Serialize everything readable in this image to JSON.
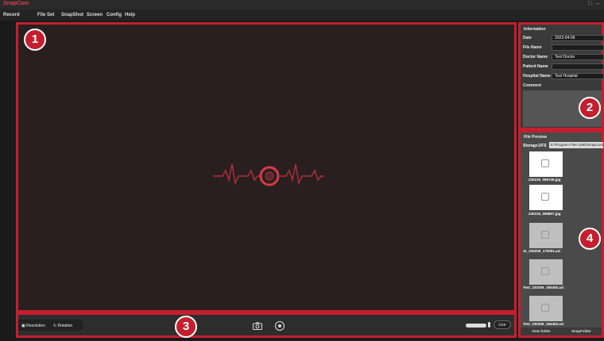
{
  "app": {
    "title": "SnapCam"
  },
  "menu": [
    "Record",
    "File Set",
    "SnapShot",
    "Screen",
    "Config",
    "Help"
  ],
  "badges": {
    "b1": "1",
    "b2": "2",
    "b3": "3",
    "b4": "4"
  },
  "info": {
    "title": "Information",
    "rows": [
      {
        "label": "Date",
        "value": "2023-04-06"
      },
      {
        "label": "File Name",
        "value": ""
      },
      {
        "label": "Doctor Name",
        "value": "Test Doctor"
      },
      {
        "label": "Patient Name",
        "value": ""
      },
      {
        "label": "Hospital Name",
        "value": "Test Hospital"
      },
      {
        "label": "Comment",
        "value": ""
      }
    ]
  },
  "preview": {
    "title": "File Preview",
    "tab_storage": "Storage",
    "tab_fps": "1/FS",
    "path": "E:\\Program Files (x86)\\SnapCam",
    "files": [
      "230216_095749.jpg",
      "230216_095807.jpg",
      "11_230209_170001.avi",
      "Test_230306_190400.avi",
      "Test_230306_194453.avi"
    ],
    "btn_view": "View folder",
    "btn_snap": "SnapFolder"
  },
  "toolbar": {
    "resolution": "Resolution",
    "rotation": "Rotation",
    "live": "Live"
  },
  "colors": {
    "accent": "#c41f2f",
    "brand": "#d93b4a"
  }
}
